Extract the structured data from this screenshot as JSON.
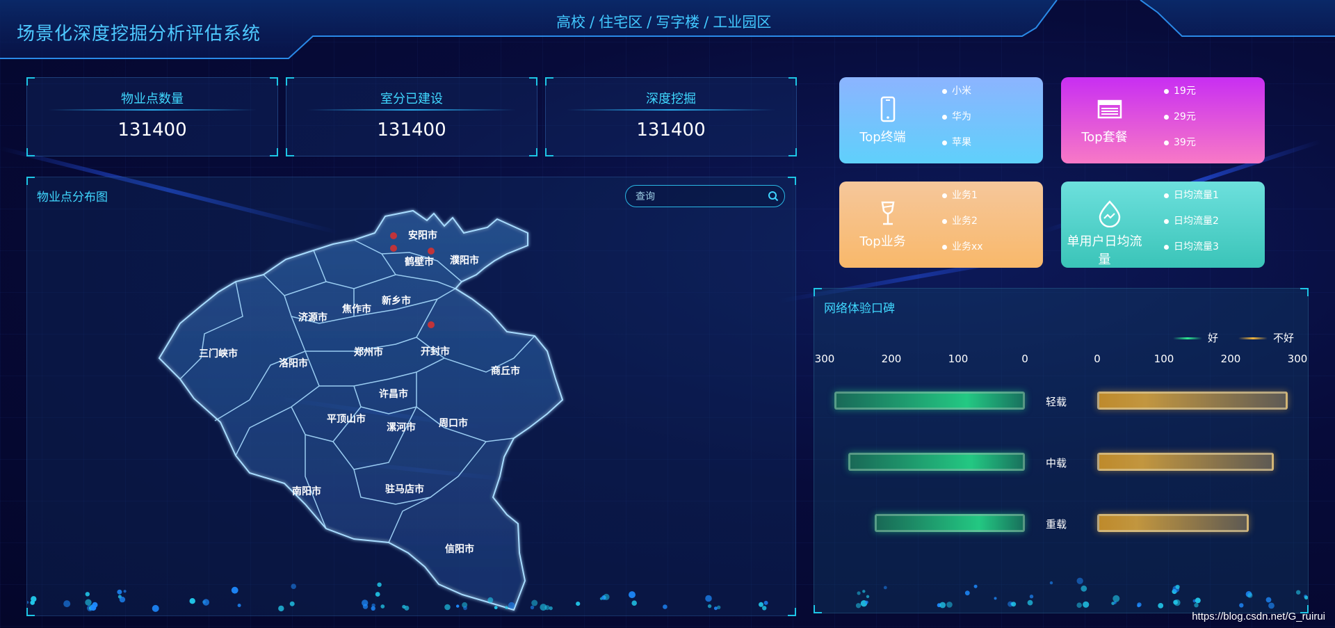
{
  "header": {
    "title": "场景化深度挖掘分析评估系统",
    "nav": [
      "高校",
      "住宅区",
      "写字楼",
      "工业园区"
    ],
    "nav_sep": "/"
  },
  "stats": [
    {
      "label": "物业点数量",
      "value": "131400"
    },
    {
      "label": "室分已建设",
      "value": "131400"
    },
    {
      "label": "深度挖掘",
      "value": "131400"
    }
  ],
  "map": {
    "title": "物业点分布图",
    "search_placeholder": "查询",
    "cities": [
      "安阳市",
      "鹤壁市",
      "濮阳市",
      "新乡市",
      "焦作市",
      "济源市",
      "三门峡市",
      "洛阳市",
      "郑州市",
      "开封市",
      "商丘市",
      "许昌市",
      "平顶山市",
      "漯河市",
      "周口市",
      "南阳市",
      "驻马店市",
      "信阳市"
    ]
  },
  "cards": [
    {
      "title": "Top终端",
      "icon": "phone-icon",
      "items": [
        "小米",
        "华为",
        "苹果"
      ]
    },
    {
      "title": "Top套餐",
      "icon": "newspaper-icon",
      "items": [
        "19元",
        "29元",
        "39元"
      ]
    },
    {
      "title": "Top业务",
      "icon": "wineglass-icon",
      "items": [
        "业务1",
        "业务2",
        "业务xx"
      ]
    },
    {
      "title": "单用户日均流量",
      "icon": "waterdrop-icon",
      "items": [
        "日均流量1",
        "日均流量2",
        "日均流量3"
      ]
    }
  ],
  "network": {
    "title": "网络体验口碑",
    "legend": [
      "好",
      "不好"
    ],
    "colors": {
      "good": "#2ee890",
      "bad": "#f0b43c"
    },
    "left_ticks": [
      "300",
      "200",
      "100",
      "0"
    ],
    "right_ticks": [
      "0",
      "100",
      "200",
      "300"
    ]
  },
  "chart_data": {
    "type": "bar",
    "categories": [
      "轻载",
      "中载",
      "重载"
    ],
    "series": [
      {
        "name": "好",
        "values": [
          285,
          265,
          225
        ]
      },
      {
        "name": "不好",
        "values": [
          285,
          265,
          227
        ]
      }
    ],
    "xlim": [
      0,
      300
    ],
    "legend_position": "top-right"
  },
  "watermark": "https://blog.csdn.net/G_ruirui"
}
